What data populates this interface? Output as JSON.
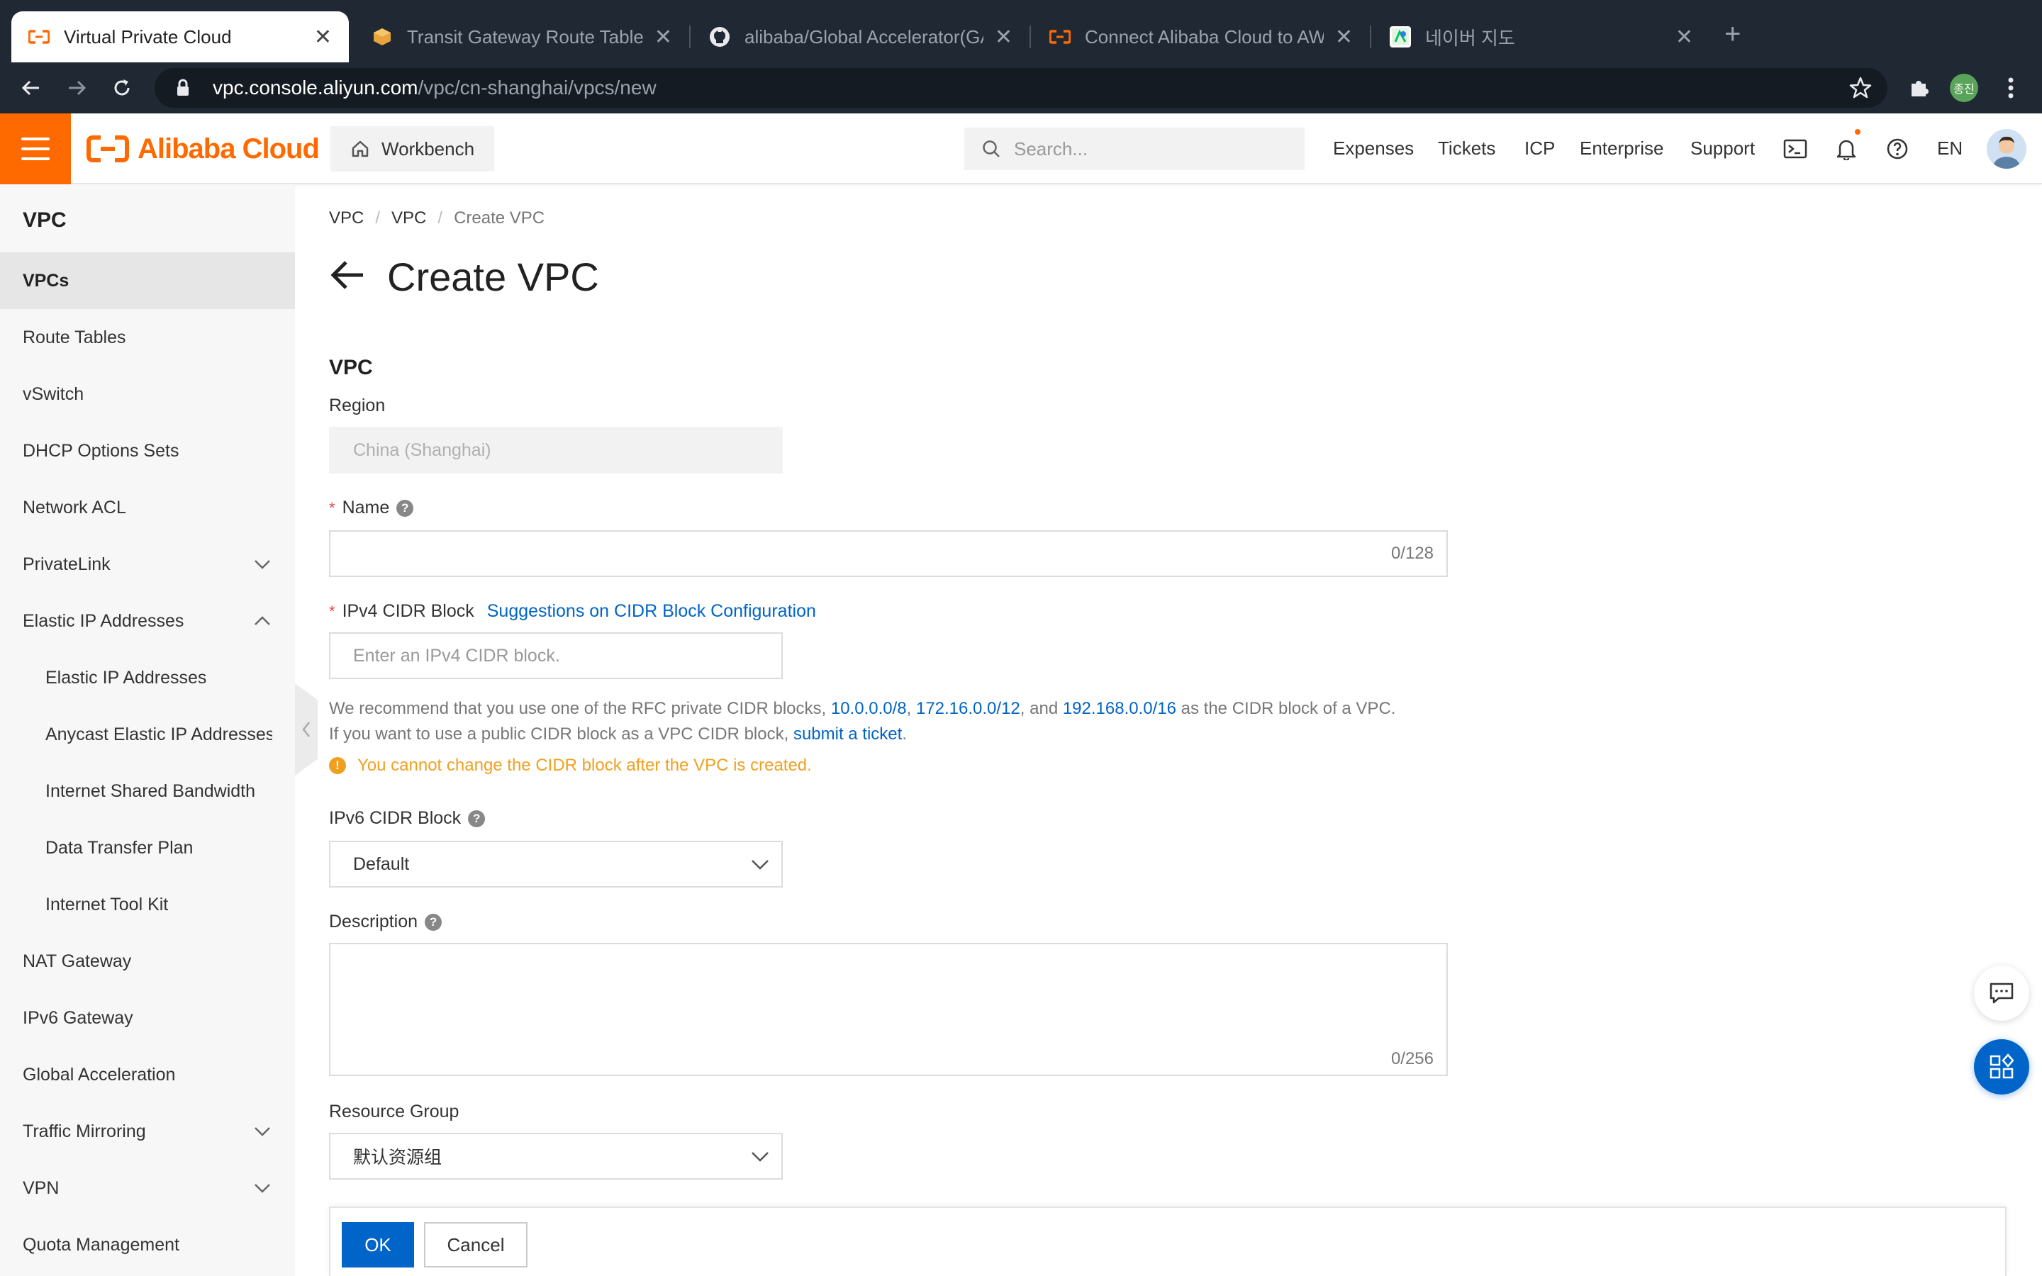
{
  "browser": {
    "tabs": [
      {
        "title": "Virtual Private Cloud",
        "icon": "alibaba-cloud-icon",
        "active": true
      },
      {
        "title": "Transit Gateway Route Tables |",
        "icon": "aws-box-icon",
        "active": false
      },
      {
        "title": "alibaba/Global Accelerator(GA)",
        "icon": "github-icon",
        "active": false
      },
      {
        "title": "Connect Alibaba Cloud to AWS",
        "icon": "alibaba-cloud-icon",
        "active": false
      },
      {
        "title": "네이버 지도",
        "icon": "naver-map-icon",
        "active": false
      }
    ],
    "url": {
      "host": "vpc.console.aliyun.com",
      "path": "/vpc/cn-shanghai/vpcs/new"
    },
    "profile_badge": "종진"
  },
  "console": {
    "brand": "Alibaba Cloud",
    "workbench": "Workbench",
    "search_placeholder": "Search...",
    "nav": [
      "Expenses",
      "Tickets",
      "ICP",
      "Enterprise",
      "Support"
    ],
    "language": "EN"
  },
  "sidebar": {
    "title": "VPC",
    "items": [
      {
        "label": "VPCs",
        "active": true
      },
      {
        "label": "Route Tables"
      },
      {
        "label": "vSwitch"
      },
      {
        "label": "DHCP Options Sets"
      },
      {
        "label": "Network ACL"
      },
      {
        "label": "PrivateLink",
        "chevron": "down"
      },
      {
        "label": "Elastic IP Addresses",
        "chevron": "up"
      },
      {
        "label": "Elastic IP Addresses",
        "sub": true
      },
      {
        "label": "Anycast Elastic IP Addresses",
        "sub": true
      },
      {
        "label": "Internet Shared Bandwidth",
        "sub": true
      },
      {
        "label": "Data Transfer Plan",
        "sub": true
      },
      {
        "label": "Internet Tool Kit",
        "sub": true
      },
      {
        "label": "NAT Gateway"
      },
      {
        "label": "IPv6 Gateway"
      },
      {
        "label": "Global Acceleration"
      },
      {
        "label": "Traffic Mirroring",
        "chevron": "down"
      },
      {
        "label": "VPN",
        "chevron": "down"
      },
      {
        "label": "Quota Management"
      }
    ]
  },
  "page": {
    "breadcrumb": [
      "VPC",
      "VPC",
      "Create VPC"
    ],
    "title": "Create VPC",
    "section": "VPC",
    "region": {
      "label": "Region",
      "value": "China (Shanghai)"
    },
    "name": {
      "label": "Name",
      "value": "",
      "counter": "0/128"
    },
    "ipv4": {
      "label": "IPv4 CIDR Block",
      "link": "Suggestions on CIDR Block Configuration",
      "placeholder": "Enter an IPv4 CIDR block.",
      "hint_prefix": "We recommend that you use one of the RFC private CIDR blocks, ",
      "cidr_1": "10.0.0.0/8",
      "comma": ", ",
      "cidr_2": "172.16.0.0/12",
      "and": ", and ",
      "cidr_3": "192.168.0.0/16",
      "hint_suffix": " as the CIDR block of a VPC.",
      "hint2_prefix": "If you want to use a public CIDR block as a VPC CIDR block, ",
      "ticket_link": "submit a ticket",
      "hint2_suffix": ".",
      "warning": "You cannot change the CIDR block after the VPC is created."
    },
    "ipv6": {
      "label": "IPv6 CIDR Block",
      "value": "Default"
    },
    "description": {
      "label": "Description",
      "value": "",
      "counter": "0/256"
    },
    "resource_group": {
      "label": "Resource Group",
      "value": "默认资源组"
    },
    "ok": "OK",
    "cancel": "Cancel"
  },
  "colors": {
    "brand": "#ff6a00",
    "primary": "#0064c8",
    "warning": "#f0a020",
    "required": "#e64545"
  }
}
